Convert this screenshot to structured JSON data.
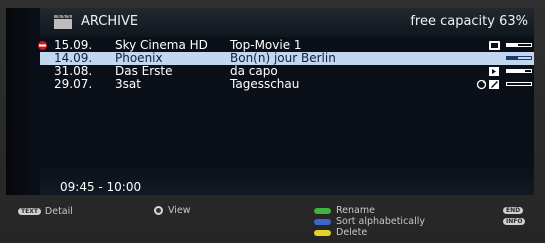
{
  "header": {
    "title": "ARCHIVE",
    "capacity": "free capacity 63%"
  },
  "recordings": [
    {
      "date": "15.09.",
      "channel": "Sky Cinema HD",
      "title": "Top-Movie 1",
      "recording": true,
      "icons": [
        "lock-icon"
      ],
      "progress": 0.45,
      "selected": false
    },
    {
      "date": "14.09.",
      "channel": "Phoenix",
      "title": "Bon(n) jour Berlin",
      "recording": false,
      "icons": [],
      "progress": 0.45,
      "selected": true
    },
    {
      "date": "31.08.",
      "channel": "Das Erste",
      "title": "da capo",
      "recording": false,
      "icons": [
        "resume-icon"
      ],
      "progress": 0.75,
      "selected": false
    },
    {
      "date": "29.07.",
      "channel": "3sat",
      "title": "Tagesschau",
      "recording": false,
      "icons": [
        "repeat-icon",
        "edited-icon"
      ],
      "progress": 0.0,
      "selected": false
    }
  ],
  "selected_time": "09:45 - 10:00",
  "footer": {
    "text_key": "TEXT",
    "detail": "Detail",
    "view": "View",
    "rename": "Rename",
    "sort": "Sort alphabetically",
    "delete": "Delete",
    "end_key": "END",
    "info_key": "INFO"
  },
  "colors": {
    "green": "#3fb23f",
    "blue": "#3a67c8",
    "yellow": "#e4d12a",
    "red": "#d01a1a",
    "selection": "#c3d6f0"
  }
}
